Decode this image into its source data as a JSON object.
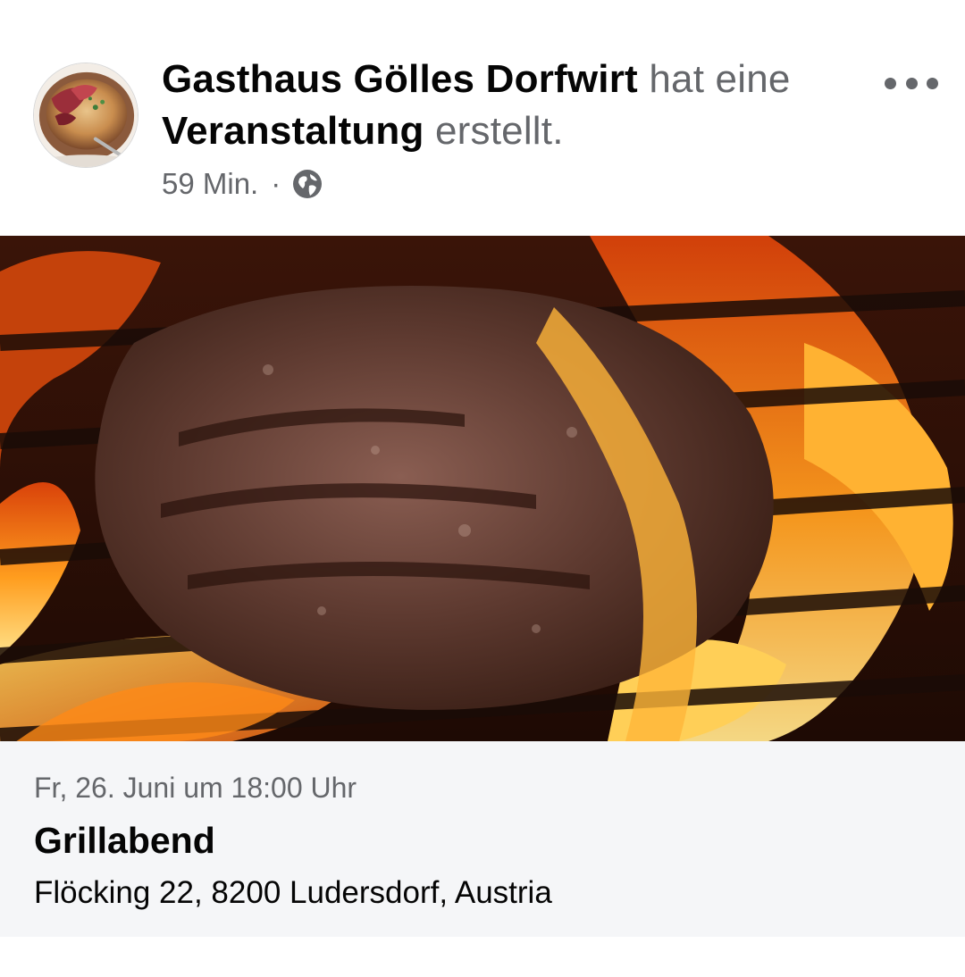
{
  "post": {
    "page_name": "Gasthaus Gölles Dorfwirt",
    "action_prefix": "hat eine",
    "object": "Veranstaltung",
    "action_suffix": "erstellt.",
    "timestamp": "59 Min.",
    "separator": "·",
    "privacy_icon": "globe-icon",
    "more_icon": "more-options-icon"
  },
  "event": {
    "cover_description_icon": "steak-on-grill-photo",
    "date": "Fr, 26. Juni um 18:00 Uhr",
    "title": "Grillabend",
    "location": "Flöcking 22, 8200 Ludersdorf, Austria"
  },
  "colors": {
    "text_primary": "#050505",
    "text_secondary": "#65676b",
    "info_background": "#f5f6f8"
  }
}
